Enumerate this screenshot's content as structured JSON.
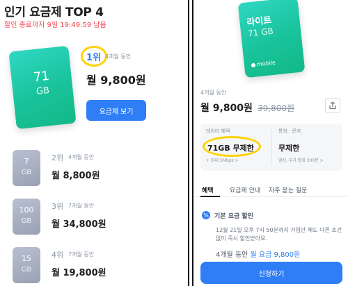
{
  "left": {
    "title": "인기 요금제 TOP 4",
    "countdown": "할인 종료까지 9일 19:49:59 남음",
    "featured": {
      "card_num": "71",
      "card_unit": "GB",
      "rank": "1위",
      "period": "4개월 동안",
      "price": "월 9,800원",
      "button": "요금제 보기"
    },
    "plans": [
      {
        "card_num": "7",
        "card_unit": "GB",
        "rank": "2위",
        "period": "4개월 동안",
        "price": "월 8,800원"
      },
      {
        "card_num": "100",
        "card_unit": "GB",
        "rank": "3위",
        "period": "7개월 동안",
        "price": "월 34,800원"
      },
      {
        "card_num": "15",
        "card_unit": "GB",
        "rank": "4위",
        "period": "7개월 동안",
        "price": "월 19,800원"
      }
    ]
  },
  "right": {
    "card": {
      "name": "라이트",
      "gb": "71 GB",
      "brand": "mobile"
    },
    "period": "4개월 동안",
    "price": "월 9,800원",
    "old_price": "39,800원",
    "info": {
      "data_label": "데이터 혜택",
      "data_value": "71GB 무제한",
      "data_sub": "+ 최대 3Mbps >",
      "call_label": "통화 · 문자",
      "call_value": "무제한",
      "call_sub": "영상, 부가 통화 300분 >"
    },
    "tabs": [
      "혜택",
      "요금제 안내",
      "자주 묻는 질문"
    ],
    "discount": {
      "title": "기본 요금 할인",
      "desc": "12월 21일 오후 7시 50분까지 가입만 해도 다른 조건없이 즉시 할인받아요.",
      "price_prefix": "4개월 동안 ",
      "price_value": "월 요금 9,800원"
    },
    "apply_button": "신청하기"
  },
  "colors": {
    "accent": "#2f7ef5",
    "highlight": "#ffd200",
    "alert": "#f04452",
    "card_green": "#19c39b"
  }
}
